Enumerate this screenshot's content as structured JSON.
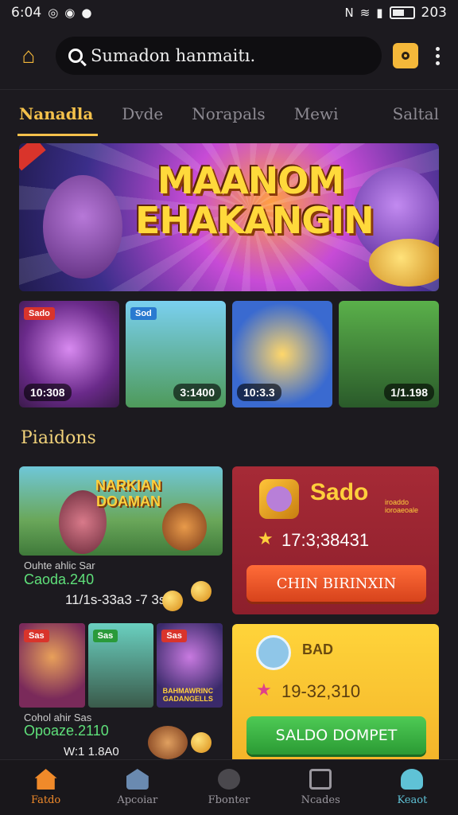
{
  "status_bar": {
    "time": "6:04",
    "battery_text": "203"
  },
  "search": {
    "placeholder": "Sumadon hanmaitı."
  },
  "tabs": [
    {
      "label": "Nanadla",
      "active": true
    },
    {
      "label": "Dvde"
    },
    {
      "label": "Norapals"
    },
    {
      "label": "Mewi"
    },
    {
      "label": "Saltal"
    }
  ],
  "hero": {
    "title_line1": "MAANOM",
    "title_line2": "EHAKANGIN"
  },
  "cards": [
    {
      "tag": "Sado",
      "value": "10:308"
    },
    {
      "tag": "Sod",
      "value": "3:1400"
    },
    {
      "tag": "",
      "value": "10:3.3"
    },
    {
      "tag": "",
      "value": "1/1.198"
    }
  ],
  "section": {
    "title": "Piaidons"
  },
  "feature": {
    "title": "NARKIAN\nDOAMAN",
    "caption1": "Ouhte ahlic Sar",
    "caption2": "Caoda.240",
    "caption3": "11/1s-33a3 -7 3s0"
  },
  "grid": {
    "tags": [
      "Sas",
      "Sas",
      "Sas"
    ],
    "card3_text": "BAHMAWRINC\nGADANGELLS",
    "caption1": "Cohol ahir Sas",
    "caption2": "Opoaze.2110",
    "caption3": "W:1 1.8A0"
  },
  "balance": {
    "title": "Sado",
    "subtitle": "iroaddo ioroaeoale",
    "value": "17:3;38431",
    "button_label": "CHIN BIRINXIN",
    "color": "#a62a36"
  },
  "wallet": {
    "title": "BAD",
    "value": "19-32,310",
    "button_label": "SALDO DOMPET",
    "color": "#ffd43a"
  },
  "nav": [
    {
      "label": "Fatdo",
      "icon": "home-icon"
    },
    {
      "label": "Apcoiar",
      "icon": "store-icon"
    },
    {
      "label": "Fbonter",
      "icon": "tools-icon"
    },
    {
      "label": "Ncades",
      "icon": "list-icon"
    },
    {
      "label": "Keaot",
      "icon": "profile-icon"
    }
  ]
}
